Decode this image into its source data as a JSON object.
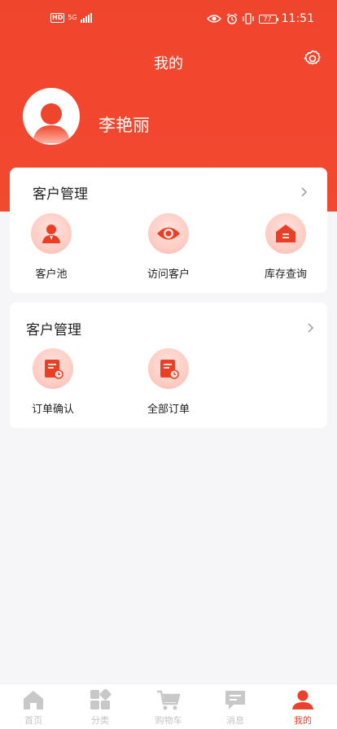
{
  "status_bar": {
    "network_badge": "HD",
    "network_type": "5G",
    "battery": "77",
    "time": "11:51"
  },
  "header": {
    "title": "我的",
    "settings_icon": "gear-icon"
  },
  "profile": {
    "name": "李艳丽",
    "avatar_icon": "user-avatar-icon"
  },
  "sections": [
    {
      "title": "客户管理",
      "items": [
        {
          "label": "客户池",
          "icon": "customer-pool-icon"
        },
        {
          "label": "访问客户",
          "icon": "eye-icon"
        },
        {
          "label": "库存查询",
          "icon": "warehouse-icon"
        }
      ]
    },
    {
      "title": "客户管理",
      "items": [
        {
          "label": "订单确认",
          "icon": "order-confirm-icon"
        },
        {
          "label": "全部订单",
          "icon": "all-orders-icon"
        }
      ]
    }
  ],
  "tabbar": {
    "items": [
      {
        "label": "首页",
        "icon": "home-icon"
      },
      {
        "label": "分类",
        "icon": "category-icon"
      },
      {
        "label": "购物车",
        "icon": "cart-icon"
      },
      {
        "label": "消息",
        "icon": "message-icon"
      },
      {
        "label": "我的",
        "icon": "profile-icon"
      }
    ],
    "active": "我的"
  },
  "colors": {
    "brand_red": "#f0452d",
    "tab_inactive": "#c4c4c4",
    "tab_active": "#e8432c"
  }
}
